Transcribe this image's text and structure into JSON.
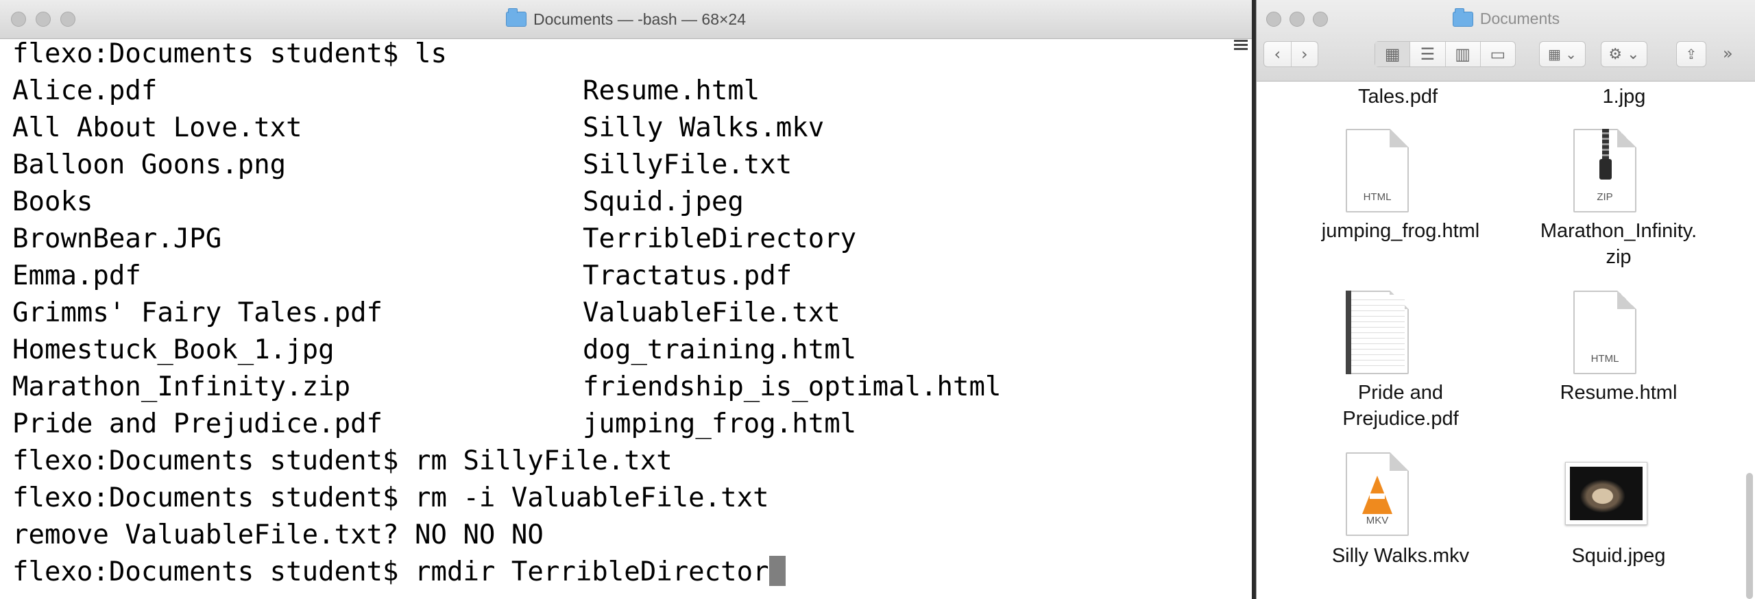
{
  "terminal": {
    "title": "Documents — -bash — 68×24",
    "prompt": "flexo:Documents student$",
    "ls_command": "ls",
    "ls_left": [
      "Alice.pdf",
      "All About Love.txt",
      "Balloon Goons.png",
      "Books",
      "BrownBear.JPG",
      "Emma.pdf",
      "Grimms' Fairy Tales.pdf",
      "Homestuck_Book_1.jpg",
      "Marathon_Infinity.zip",
      "Pride and Prejudice.pdf"
    ],
    "ls_right": [
      "Resume.html",
      "Silly Walks.mkv",
      "SillyFile.txt",
      "Squid.jpeg",
      "TerribleDirectory",
      "Tractatus.pdf",
      "ValuableFile.txt",
      "dog_training.html",
      "friendship_is_optimal.html",
      "jumping_frog.html"
    ],
    "cmd1": "rm SillyFile.txt",
    "cmd2": "rm -i ValuableFile.txt",
    "confirm_prompt": "remove ValuableFile.txt?",
    "confirm_answer": "NO NO NO",
    "cmd3_partial": "rmdir TerribleDirector"
  },
  "finder": {
    "title": "Documents",
    "partial_labels": [
      "Tales.pdf",
      "1.jpg"
    ],
    "files": [
      {
        "name_line1": "jumping_frog.html",
        "name_line2": "",
        "icon": "html-document-icon",
        "ext": "HTML"
      },
      {
        "name_line1": "Marathon_Infinity.",
        "name_line2": "zip",
        "icon": "zip-archive-icon",
        "ext": "ZIP"
      },
      {
        "name_line1": "Pride and",
        "name_line2": "Prejudice.pdf",
        "icon": "pdf-document-icon",
        "ext": ""
      },
      {
        "name_line1": "Resume.html",
        "name_line2": "",
        "icon": "html-document-icon",
        "ext": "HTML"
      },
      {
        "name_line1": "Silly Walks.mkv",
        "name_line2": "",
        "icon": "mkv-video-icon",
        "ext": "MKV"
      },
      {
        "name_line1": "Squid.jpeg",
        "name_line2": "",
        "icon": "image-thumbnail-icon",
        "ext": ""
      }
    ]
  }
}
